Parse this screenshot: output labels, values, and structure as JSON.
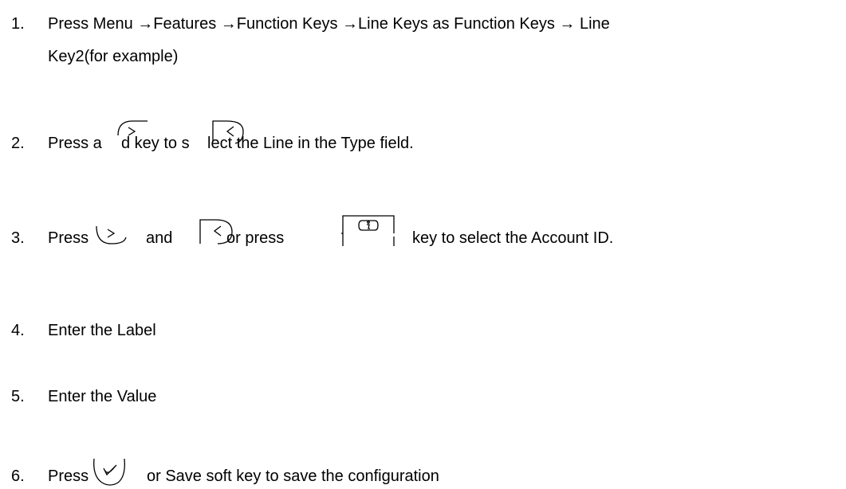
{
  "steps": [
    {
      "number": "1.",
      "text_line1": "Press Menu →Features →Function Keys →Line Keys as Function Keys →  Line",
      "text_line2": "Key2(for example)"
    },
    {
      "number": "2.",
      "seg1": "Press a",
      "seg2": "d key to s",
      "seg3": "lect the Line in the Type field."
    },
    {
      "number": "3.",
      "seg1": "Press",
      "seg2": "and",
      "seg3": "or press",
      "seg4": "key to select the Account ID."
    },
    {
      "number": "4.",
      "text": "Enter the Label"
    },
    {
      "number": "5.",
      "text": "Enter the Value"
    },
    {
      "number": "6.",
      "seg1": "Press",
      "seg2": "or Save soft key to save the configuration"
    }
  ],
  "icons": {
    "right": "right-arrow-key-icon",
    "left": "left-arrow-key-icon",
    "info": "info-key-icon",
    "ok": "ok-key-icon"
  }
}
